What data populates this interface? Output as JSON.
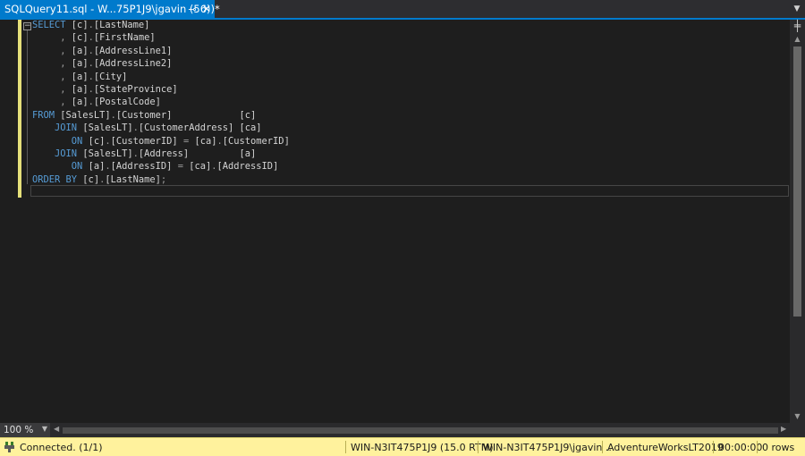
{
  "tab": {
    "title": "SQLQuery11.sql - W...75P1J9\\jgavin (56))*",
    "pin_glyph": "⊸",
    "close_glyph": "✕",
    "dropdown_glyph": "▼"
  },
  "editor": {
    "lines": [
      [
        {
          "t": "SELECT",
          "c": "kw"
        },
        {
          "t": " [c]"
        },
        {
          "t": ".",
          "c": "pn"
        },
        {
          "t": "[LastName]"
        }
      ],
      [
        {
          "t": "     "
        },
        {
          "t": ",",
          "c": "pn"
        },
        {
          "t": " [c]"
        },
        {
          "t": ".",
          "c": "pn"
        },
        {
          "t": "[FirstName]"
        }
      ],
      [
        {
          "t": "     "
        },
        {
          "t": ",",
          "c": "pn"
        },
        {
          "t": " [a]"
        },
        {
          "t": ".",
          "c": "pn"
        },
        {
          "t": "[AddressLine1]"
        }
      ],
      [
        {
          "t": "     "
        },
        {
          "t": ",",
          "c": "pn"
        },
        {
          "t": " [a]"
        },
        {
          "t": ".",
          "c": "pn"
        },
        {
          "t": "[AddressLine2]"
        }
      ],
      [
        {
          "t": "     "
        },
        {
          "t": ",",
          "c": "pn"
        },
        {
          "t": " [a]"
        },
        {
          "t": ".",
          "c": "pn"
        },
        {
          "t": "[City]"
        }
      ],
      [
        {
          "t": "     "
        },
        {
          "t": ",",
          "c": "pn"
        },
        {
          "t": " [a]"
        },
        {
          "t": ".",
          "c": "pn"
        },
        {
          "t": "[StateProvince]"
        }
      ],
      [
        {
          "t": "     "
        },
        {
          "t": ",",
          "c": "pn"
        },
        {
          "t": " [a]"
        },
        {
          "t": ".",
          "c": "pn"
        },
        {
          "t": "[PostalCode]"
        }
      ],
      [
        {
          "t": "FROM",
          "c": "kw"
        },
        {
          "t": " [SalesLT]"
        },
        {
          "t": ".",
          "c": "pn"
        },
        {
          "t": "[Customer]            [c]"
        }
      ],
      [
        {
          "t": "    "
        },
        {
          "t": "JOIN",
          "c": "kw"
        },
        {
          "t": " [SalesLT]"
        },
        {
          "t": ".",
          "c": "pn"
        },
        {
          "t": "[CustomerAddress] [ca]"
        }
      ],
      [
        {
          "t": "       "
        },
        {
          "t": "ON",
          "c": "kw"
        },
        {
          "t": " [c]"
        },
        {
          "t": ".",
          "c": "pn"
        },
        {
          "t": "[CustomerID] "
        },
        {
          "t": "=",
          "c": "pn"
        },
        {
          "t": " [ca]"
        },
        {
          "t": ".",
          "c": "pn"
        },
        {
          "t": "[CustomerID]"
        }
      ],
      [
        {
          "t": "    "
        },
        {
          "t": "JOIN",
          "c": "kw"
        },
        {
          "t": " [SalesLT]"
        },
        {
          "t": ".",
          "c": "pn"
        },
        {
          "t": "[Address]         [a]"
        }
      ],
      [
        {
          "t": "       "
        },
        {
          "t": "ON",
          "c": "kw"
        },
        {
          "t": " [a]"
        },
        {
          "t": ".",
          "c": "pn"
        },
        {
          "t": "[AddressID] "
        },
        {
          "t": "=",
          "c": "pn"
        },
        {
          "t": " [ca]"
        },
        {
          "t": ".",
          "c": "pn"
        },
        {
          "t": "[AddressID]"
        }
      ],
      [
        {
          "t": "ORDER BY",
          "c": "kw"
        },
        {
          "t": " [c]"
        },
        {
          "t": ".",
          "c": "pn"
        },
        {
          "t": "[LastName]"
        },
        {
          "t": ";",
          "c": "pn"
        }
      ]
    ],
    "collapse_glyph": "−"
  },
  "scrollbar": {
    "split_glyph": "╪",
    "up_glyph": "▲",
    "down_glyph": "▼",
    "left_glyph": "◀",
    "right_glyph": "▶"
  },
  "zoom": {
    "value": "100 %",
    "arrow_glyph": "▼"
  },
  "status": {
    "connection": "Connected. (1/1)",
    "server": "WIN-N3IT475P1J9 (15.0 RTM)",
    "user": "WIN-N3IT475P1J9\\jgavin ...",
    "database": "AdventureWorksLT2019",
    "elapsed": "00:00:00",
    "rows": "0 rows"
  },
  "colors": {
    "accent": "#007acc",
    "keyword": "#569cd6",
    "punctuation": "#9b9b9b",
    "identifier": "#d4d4d4",
    "status_bar": "#fff29d",
    "change_margin": "#e5e07a"
  },
  "icons": {
    "connection": "connected-plug-icon"
  }
}
